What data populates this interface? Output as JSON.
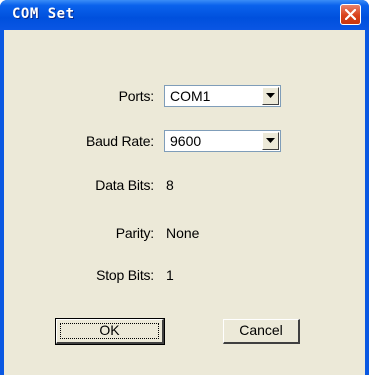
{
  "window": {
    "title": "COM Set",
    "accent": "#0a58e2",
    "close_icon": "close-icon"
  },
  "form": {
    "ports": {
      "label": "Ports:",
      "value": "COM1"
    },
    "baud_rate": {
      "label": "Baud Rate:",
      "value": "9600"
    },
    "data_bits": {
      "label": "Data Bits:",
      "value": "8"
    },
    "parity": {
      "label": "Parity:",
      "value": "None"
    },
    "stop_bits": {
      "label": "Stop Bits:",
      "value": "1"
    }
  },
  "buttons": {
    "ok_label": "OK",
    "cancel_label": "Cancel"
  }
}
